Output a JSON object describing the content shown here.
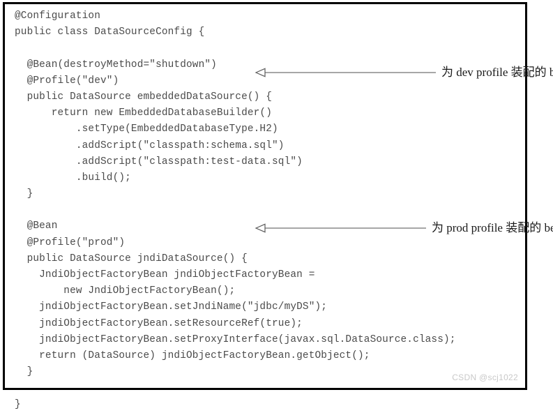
{
  "figure": {
    "kind": "code-listing-figure",
    "language": "java",
    "border_color": "#000000",
    "background_color": "#ffffff",
    "code_text_color": "#4a4a4a",
    "annotation_text_color": "#1a1a1a",
    "annotation_line_color": "#808080",
    "watermark_color": "#c9c9c9"
  },
  "code": {
    "lines": [
      "@Configuration",
      "public class DataSourceConfig {",
      "",
      "  @Bean(destroyMethod=\"shutdown\")",
      "  @Profile(\"dev\")",
      "  public DataSource embeddedDataSource() {",
      "      return new EmbeddedDatabaseBuilder()",
      "          .setType(EmbeddedDatabaseType.H2)",
      "          .addScript(\"classpath:schema.sql\")",
      "          .addScript(\"classpath:test-data.sql\")",
      "          .build();",
      "  }",
      "",
      "  @Bean",
      "  @Profile(\"prod\")",
      "  public DataSource jndiDataSource() {",
      "    JndiObjectFactoryBean jndiObjectFactoryBean =",
      "        new JndiObjectFactoryBean();",
      "    jndiObjectFactoryBean.setJndiName(\"jdbc/myDS\");",
      "    jndiObjectFactoryBean.setResourceRef(true);",
      "    jndiObjectFactoryBean.setProxyInterface(javax.sql.DataSource.class);",
      "    return (DataSource) jndiObjectFactoryBean.getObject();",
      "  }",
      "",
      "}"
    ]
  },
  "annotations": [
    {
      "id": "dev",
      "label": "为 dev profile 装配的 bean",
      "arrow_direction": "left",
      "targets_line": "@Profile(\"dev\")"
    },
    {
      "id": "prod",
      "label": "为 prod profile 装配的 bean",
      "arrow_direction": "left",
      "targets_line": "@Profile(\"prod\")"
    }
  ],
  "watermark": {
    "text": "CSDN @scj1022"
  }
}
